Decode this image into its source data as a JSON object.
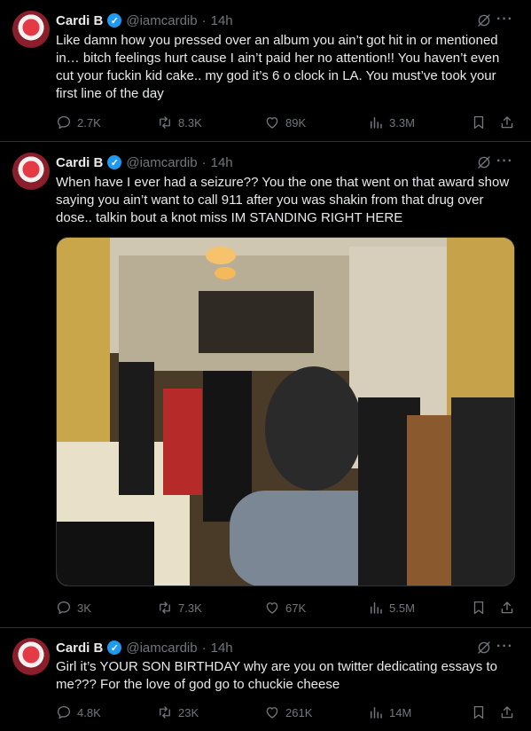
{
  "tweets": [
    {
      "name": "Cardi B",
      "handle": "@iamcardib",
      "dot": "·",
      "time": "14h",
      "text": "Like damn how you pressed over an album you ain’t got hit in or mentioned in… bitch feelings hurt cause I ain’t paid her no attention!!  You haven’t even cut your fuckin kid cake.. my god it’s 6 o clock in LA. You must’ve took your first line of the day",
      "replies": "2.7K",
      "reposts": "8.3K",
      "likes": "89K",
      "views": "3.3M"
    },
    {
      "name": "Cardi B",
      "handle": "@iamcardib",
      "dot": "·",
      "time": "14h",
      "text": "When have I ever had a seizure?? You the one that went on that award show saying you ain’t want to call 911 after you was shakin from that drug over dose.. talkin bout a knot miss IM STANDING RIGHT HERE",
      "replies": "3K",
      "reposts": "7.3K",
      "likes": "67K",
      "views": "5.5M"
    },
    {
      "name": "Cardi B",
      "handle": "@iamcardib",
      "dot": "·",
      "time": "14h",
      "text": "Girl it’s YOUR SON BIRTHDAY why are you on twitter dedicating essays to me??? For the love of god go to chuckie cheese",
      "replies": "4.8K",
      "reposts": "23K",
      "likes": "261K",
      "views": "14M"
    }
  ],
  "icons": {
    "verified": "verified-badge-icon",
    "grok": "grok-icon",
    "more": "more-icon",
    "reply": "reply-icon",
    "repost": "repost-icon",
    "like": "like-icon",
    "views": "views-icon",
    "bookmark": "bookmark-icon",
    "share": "share-icon"
  },
  "glyphs": {
    "check": "✓",
    "more": "···"
  },
  "colors": {
    "background": "#000000",
    "text": "#e7e9ea",
    "muted": "#71767b",
    "verified": "#1d9bf0",
    "border": "#2f3336"
  }
}
